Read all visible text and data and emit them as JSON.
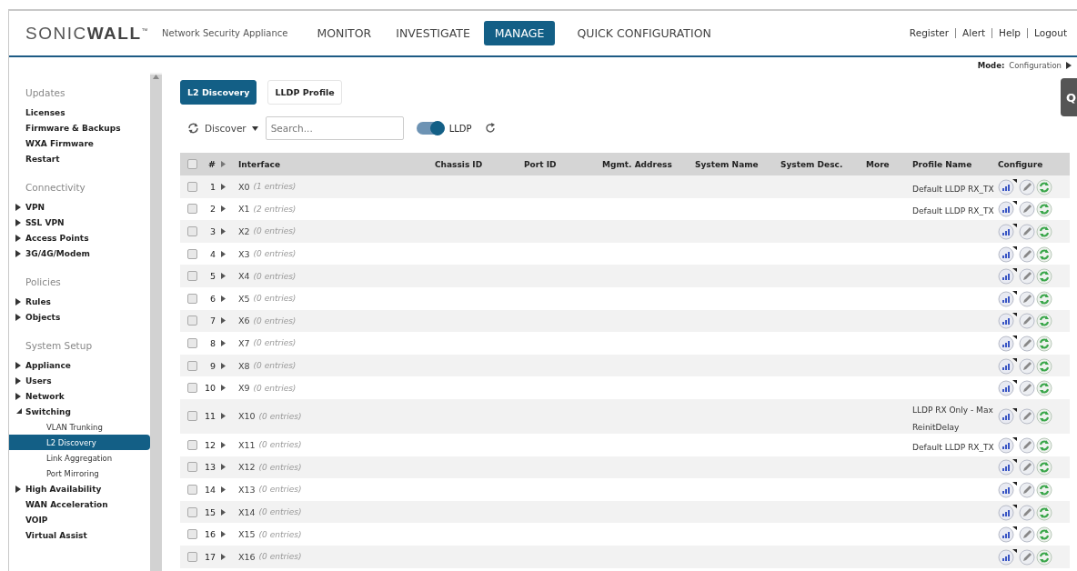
{
  "header": {
    "logo": "SONIC**WALL**$^{™}$",
    "subtitle": "Network Security Appliance",
    "nav": [
      {
        "label": "MONITOR",
        "selected": false
      },
      {
        "label": "INVESTIGATE",
        "selected": false
      },
      {
        "label": "MANAGE",
        "selected": true
      },
      {
        "label": "QUICK CONFIGURATION",
        "selected": false
      }
    ],
    "links": [
      "Register",
      "Alert",
      "Help",
      "Logout"
    ]
  },
  "mode": {
    "label": "Mode:",
    "value": "Configuration"
  },
  "side_tab": "Q",
  "sidebar": {
    "sections": [
      {
        "heading": "Updates",
        "items": [
          {
            "label": "Licenses",
            "kind": "page",
            "selected": false
          },
          {
            "label": "Firmware & Backups",
            "kind": "page",
            "selected": false
          },
          {
            "label": "WXA Firmware",
            "kind": "page",
            "selected": false
          },
          {
            "label": "Restart",
            "kind": "page",
            "selected": false
          }
        ]
      },
      {
        "heading": "Connectivity",
        "items": [
          {
            "label": "VPN",
            "kind": "folder",
            "expanded": false,
            "selected": false
          },
          {
            "label": "SSL VPN",
            "kind": "folder",
            "expanded": false,
            "selected": false
          },
          {
            "label": "Access Points",
            "kind": "folder",
            "expanded": false,
            "selected": false
          },
          {
            "label": "3G/4G/Modem",
            "kind": "folder",
            "expanded": false,
            "selected": false
          }
        ]
      },
      {
        "heading": "Policies",
        "items": [
          {
            "label": "Rules",
            "kind": "folder",
            "expanded": false,
            "selected": false
          },
          {
            "label": "Objects",
            "kind": "folder",
            "expanded": false,
            "selected": false
          }
        ]
      },
      {
        "heading": "System Setup",
        "items": [
          {
            "label": "Appliance",
            "kind": "folder",
            "expanded": false,
            "selected": false
          },
          {
            "label": "Users",
            "kind": "folder",
            "expanded": false,
            "selected": false
          },
          {
            "label": "Network",
            "kind": "folder",
            "expanded": false,
            "selected": false
          },
          {
            "label": "Switching",
            "kind": "folder",
            "expanded": true,
            "selected": false,
            "children": [
              {
                "label": "VLAN Trunking",
                "selected": false
              },
              {
                "label": "L2 Discovery",
                "selected": true
              },
              {
                "label": "Link Aggregation",
                "selected": false
              },
              {
                "label": "Port Mirroring",
                "selected": false
              }
            ]
          },
          {
            "label": "High Availability",
            "kind": "folder",
            "expanded": false,
            "selected": false
          },
          {
            "label": "WAN Acceleration",
            "kind": "page",
            "selected": false
          },
          {
            "label": "VOIP",
            "kind": "page",
            "selected": false
          },
          {
            "label": "Virtual Assist",
            "kind": "page",
            "selected": false
          }
        ]
      }
    ]
  },
  "tabs": [
    {
      "label": "L2 Discovery",
      "selected": true
    },
    {
      "label": "LLDP Profile",
      "selected": false
    }
  ],
  "toolbar": {
    "discover": "Discover",
    "search": {
      "placeholder": "Search..."
    },
    "toggle": {
      "label": "LLDP",
      "on": true
    }
  },
  "table": {
    "header_checked": false,
    "columns": [
      "#",
      "Interface",
      "Chassis ID",
      "Port ID",
      "Mgmt. Address",
      "System Name",
      "System Desc.",
      "More",
      "Profile Name",
      "Configure"
    ],
    "rows": [
      {
        "checked": false,
        "number": "1",
        "interface": "X0",
        "entries": "(1 entries)",
        "profile": "Default LLDP RX_TX"
      },
      {
        "checked": false,
        "number": "2",
        "interface": "X1",
        "entries": "(2 entries)",
        "profile": "Default LLDP RX_TX"
      },
      {
        "checked": false,
        "number": "3",
        "interface": "X2",
        "entries": "(0 entries)"
      },
      {
        "checked": false,
        "number": "4",
        "interface": "X3",
        "entries": "(0 entries)"
      },
      {
        "checked": false,
        "number": "5",
        "interface": "X4",
        "entries": "(0 entries)"
      },
      {
        "checked": false,
        "number": "6",
        "interface": "X5",
        "entries": "(0 entries)"
      },
      {
        "checked": false,
        "number": "7",
        "interface": "X6",
        "entries": "(0 entries)"
      },
      {
        "checked": false,
        "number": "8",
        "interface": "X7",
        "entries": "(0 entries)"
      },
      {
        "checked": false,
        "number": "9",
        "interface": "X8",
        "entries": "(0 entries)"
      },
      {
        "checked": false,
        "number": "10",
        "interface": "X9",
        "entries": "(0 entries)"
      },
      {
        "checked": false,
        "number": "11",
        "interface": "X10",
        "entries": "(0 entries)",
        "profile": "LLDP RX Only - Max ReinitDelay"
      },
      {
        "checked": false,
        "number": "12",
        "interface": "X11",
        "entries": "(0 entries)",
        "profile": "Default LLDP RX_TX"
      },
      {
        "checked": false,
        "number": "13",
        "interface": "X12",
        "entries": "(0 entries)"
      },
      {
        "checked": false,
        "number": "14",
        "interface": "X13",
        "entries": "(0 entries)"
      },
      {
        "checked": false,
        "number": "15",
        "interface": "X14",
        "entries": "(0 entries)"
      },
      {
        "checked": false,
        "number": "16",
        "interface": "X15",
        "entries": "(0 entries)"
      },
      {
        "checked": false,
        "number": "17",
        "interface": "X16",
        "entries": "(0 entries)"
      }
    ]
  }
}
